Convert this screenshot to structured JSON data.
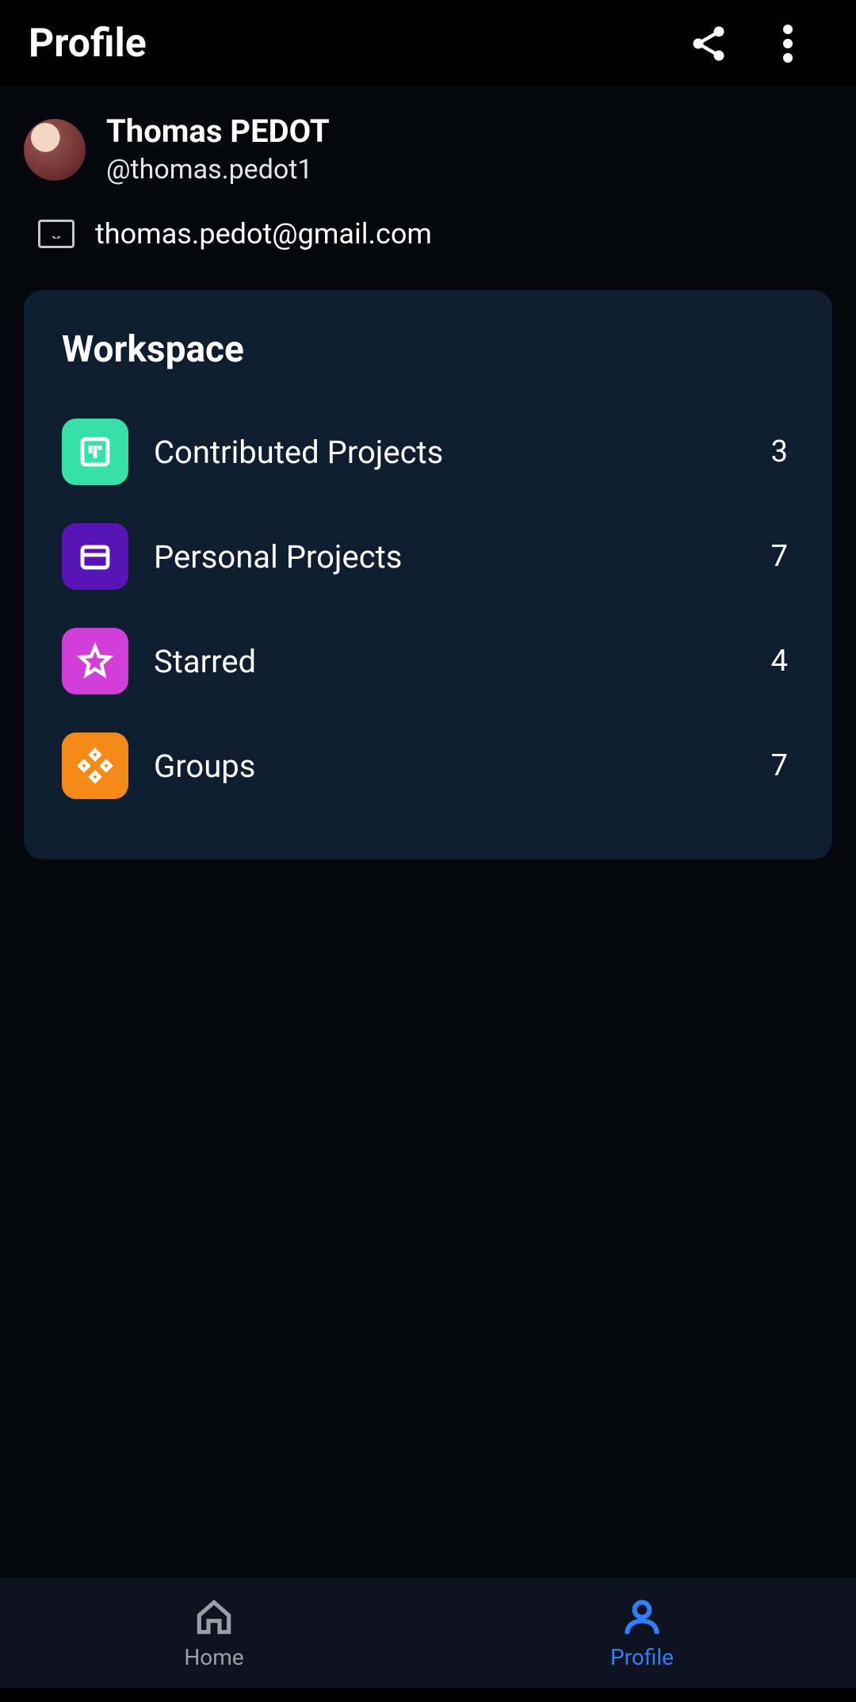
{
  "header": {
    "title": "Profile"
  },
  "user": {
    "name": "Thomas PEDOT",
    "handle": "@thomas.pedot1",
    "email": "thomas.pedot@gmail.com"
  },
  "workspace": {
    "title": "Workspace",
    "items": [
      {
        "label": "Contributed Projects",
        "count": "3",
        "iconBg": "#37e0a6",
        "icon": "board"
      },
      {
        "label": "Personal Projects",
        "count": "7",
        "iconBg": "#5914b8",
        "icon": "folder"
      },
      {
        "label": "Starred",
        "count": "4",
        "iconBg": "#d23fd8",
        "icon": "star"
      },
      {
        "label": "Groups",
        "count": "7",
        "iconBg": "#f68a18",
        "icon": "diamonds"
      }
    ]
  },
  "nav": {
    "home": "Home",
    "profile": "Profile"
  }
}
